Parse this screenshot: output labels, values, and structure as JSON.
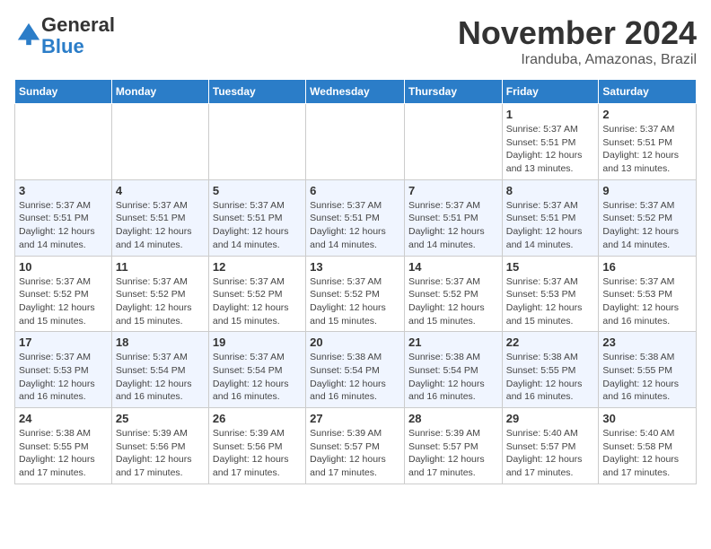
{
  "logo": {
    "general": "General",
    "blue": "Blue"
  },
  "header": {
    "month_title": "November 2024",
    "location": "Iranduba, Amazonas, Brazil"
  },
  "days_of_week": [
    "Sunday",
    "Monday",
    "Tuesday",
    "Wednesday",
    "Thursday",
    "Friday",
    "Saturday"
  ],
  "weeks": [
    [
      {
        "day": "",
        "info": ""
      },
      {
        "day": "",
        "info": ""
      },
      {
        "day": "",
        "info": ""
      },
      {
        "day": "",
        "info": ""
      },
      {
        "day": "",
        "info": ""
      },
      {
        "day": "1",
        "info": "Sunrise: 5:37 AM\nSunset: 5:51 PM\nDaylight: 12 hours\nand 13 minutes."
      },
      {
        "day": "2",
        "info": "Sunrise: 5:37 AM\nSunset: 5:51 PM\nDaylight: 12 hours\nand 13 minutes."
      }
    ],
    [
      {
        "day": "3",
        "info": "Sunrise: 5:37 AM\nSunset: 5:51 PM\nDaylight: 12 hours\nand 14 minutes."
      },
      {
        "day": "4",
        "info": "Sunrise: 5:37 AM\nSunset: 5:51 PM\nDaylight: 12 hours\nand 14 minutes."
      },
      {
        "day": "5",
        "info": "Sunrise: 5:37 AM\nSunset: 5:51 PM\nDaylight: 12 hours\nand 14 minutes."
      },
      {
        "day": "6",
        "info": "Sunrise: 5:37 AM\nSunset: 5:51 PM\nDaylight: 12 hours\nand 14 minutes."
      },
      {
        "day": "7",
        "info": "Sunrise: 5:37 AM\nSunset: 5:51 PM\nDaylight: 12 hours\nand 14 minutes."
      },
      {
        "day": "8",
        "info": "Sunrise: 5:37 AM\nSunset: 5:51 PM\nDaylight: 12 hours\nand 14 minutes."
      },
      {
        "day": "9",
        "info": "Sunrise: 5:37 AM\nSunset: 5:52 PM\nDaylight: 12 hours\nand 14 minutes."
      }
    ],
    [
      {
        "day": "10",
        "info": "Sunrise: 5:37 AM\nSunset: 5:52 PM\nDaylight: 12 hours\nand 15 minutes."
      },
      {
        "day": "11",
        "info": "Sunrise: 5:37 AM\nSunset: 5:52 PM\nDaylight: 12 hours\nand 15 minutes."
      },
      {
        "day": "12",
        "info": "Sunrise: 5:37 AM\nSunset: 5:52 PM\nDaylight: 12 hours\nand 15 minutes."
      },
      {
        "day": "13",
        "info": "Sunrise: 5:37 AM\nSunset: 5:52 PM\nDaylight: 12 hours\nand 15 minutes."
      },
      {
        "day": "14",
        "info": "Sunrise: 5:37 AM\nSunset: 5:52 PM\nDaylight: 12 hours\nand 15 minutes."
      },
      {
        "day": "15",
        "info": "Sunrise: 5:37 AM\nSunset: 5:53 PM\nDaylight: 12 hours\nand 15 minutes."
      },
      {
        "day": "16",
        "info": "Sunrise: 5:37 AM\nSunset: 5:53 PM\nDaylight: 12 hours\nand 16 minutes."
      }
    ],
    [
      {
        "day": "17",
        "info": "Sunrise: 5:37 AM\nSunset: 5:53 PM\nDaylight: 12 hours\nand 16 minutes."
      },
      {
        "day": "18",
        "info": "Sunrise: 5:37 AM\nSunset: 5:54 PM\nDaylight: 12 hours\nand 16 minutes."
      },
      {
        "day": "19",
        "info": "Sunrise: 5:37 AM\nSunset: 5:54 PM\nDaylight: 12 hours\nand 16 minutes."
      },
      {
        "day": "20",
        "info": "Sunrise: 5:38 AM\nSunset: 5:54 PM\nDaylight: 12 hours\nand 16 minutes."
      },
      {
        "day": "21",
        "info": "Sunrise: 5:38 AM\nSunset: 5:54 PM\nDaylight: 12 hours\nand 16 minutes."
      },
      {
        "day": "22",
        "info": "Sunrise: 5:38 AM\nSunset: 5:55 PM\nDaylight: 12 hours\nand 16 minutes."
      },
      {
        "day": "23",
        "info": "Sunrise: 5:38 AM\nSunset: 5:55 PM\nDaylight: 12 hours\nand 16 minutes."
      }
    ],
    [
      {
        "day": "24",
        "info": "Sunrise: 5:38 AM\nSunset: 5:55 PM\nDaylight: 12 hours\nand 17 minutes."
      },
      {
        "day": "25",
        "info": "Sunrise: 5:39 AM\nSunset: 5:56 PM\nDaylight: 12 hours\nand 17 minutes."
      },
      {
        "day": "26",
        "info": "Sunrise: 5:39 AM\nSunset: 5:56 PM\nDaylight: 12 hours\nand 17 minutes."
      },
      {
        "day": "27",
        "info": "Sunrise: 5:39 AM\nSunset: 5:57 PM\nDaylight: 12 hours\nand 17 minutes."
      },
      {
        "day": "28",
        "info": "Sunrise: 5:39 AM\nSunset: 5:57 PM\nDaylight: 12 hours\nand 17 minutes."
      },
      {
        "day": "29",
        "info": "Sunrise: 5:40 AM\nSunset: 5:57 PM\nDaylight: 12 hours\nand 17 minutes."
      },
      {
        "day": "30",
        "info": "Sunrise: 5:40 AM\nSunset: 5:58 PM\nDaylight: 12 hours\nand 17 minutes."
      }
    ]
  ]
}
